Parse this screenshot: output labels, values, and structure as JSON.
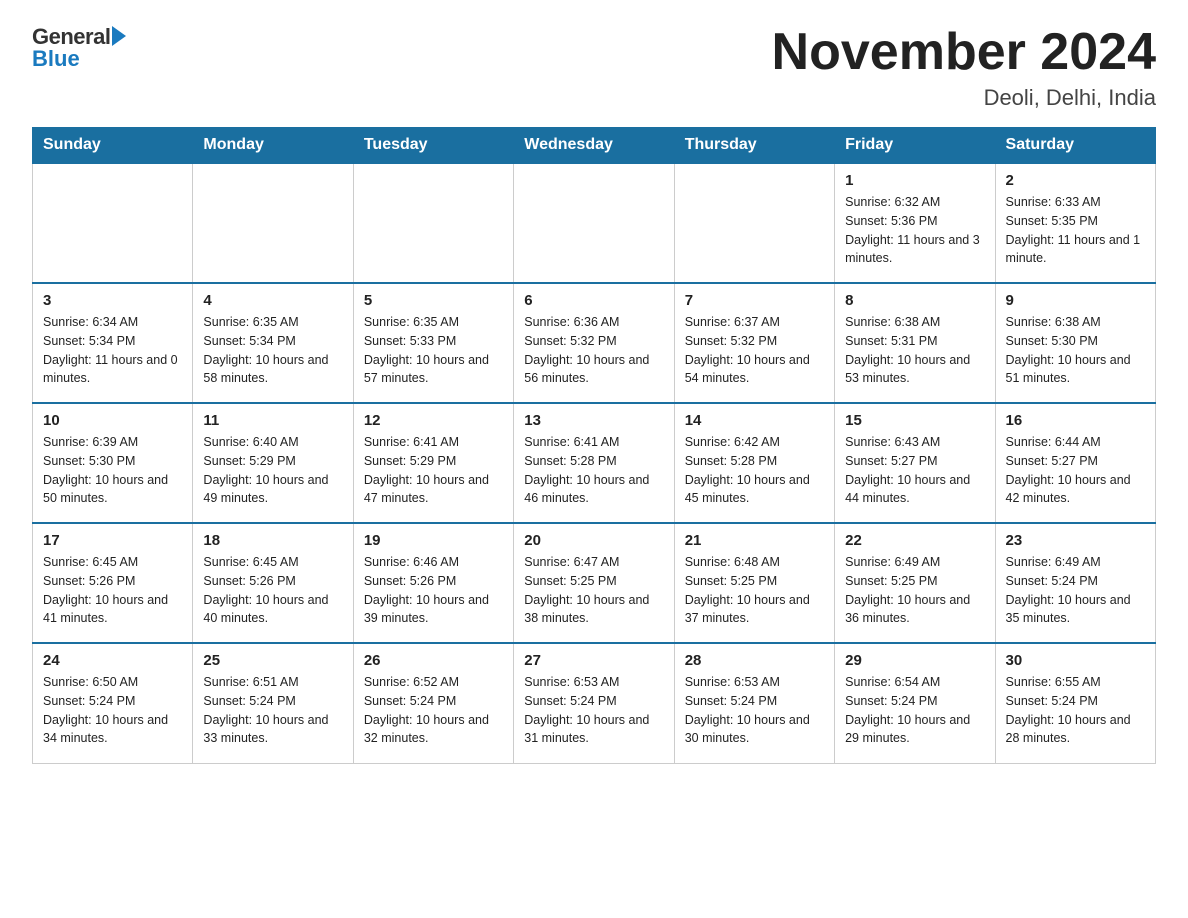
{
  "logo": {
    "general": "General",
    "blue": "Blue"
  },
  "header": {
    "month_year": "November 2024",
    "location": "Deoli, Delhi, India"
  },
  "weekdays": [
    "Sunday",
    "Monday",
    "Tuesday",
    "Wednesday",
    "Thursday",
    "Friday",
    "Saturday"
  ],
  "weeks": [
    [
      {
        "day": "",
        "info": ""
      },
      {
        "day": "",
        "info": ""
      },
      {
        "day": "",
        "info": ""
      },
      {
        "day": "",
        "info": ""
      },
      {
        "day": "",
        "info": ""
      },
      {
        "day": "1",
        "info": "Sunrise: 6:32 AM\nSunset: 5:36 PM\nDaylight: 11 hours and 3 minutes."
      },
      {
        "day": "2",
        "info": "Sunrise: 6:33 AM\nSunset: 5:35 PM\nDaylight: 11 hours and 1 minute."
      }
    ],
    [
      {
        "day": "3",
        "info": "Sunrise: 6:34 AM\nSunset: 5:34 PM\nDaylight: 11 hours and 0 minutes."
      },
      {
        "day": "4",
        "info": "Sunrise: 6:35 AM\nSunset: 5:34 PM\nDaylight: 10 hours and 58 minutes."
      },
      {
        "day": "5",
        "info": "Sunrise: 6:35 AM\nSunset: 5:33 PM\nDaylight: 10 hours and 57 minutes."
      },
      {
        "day": "6",
        "info": "Sunrise: 6:36 AM\nSunset: 5:32 PM\nDaylight: 10 hours and 56 minutes."
      },
      {
        "day": "7",
        "info": "Sunrise: 6:37 AM\nSunset: 5:32 PM\nDaylight: 10 hours and 54 minutes."
      },
      {
        "day": "8",
        "info": "Sunrise: 6:38 AM\nSunset: 5:31 PM\nDaylight: 10 hours and 53 minutes."
      },
      {
        "day": "9",
        "info": "Sunrise: 6:38 AM\nSunset: 5:30 PM\nDaylight: 10 hours and 51 minutes."
      }
    ],
    [
      {
        "day": "10",
        "info": "Sunrise: 6:39 AM\nSunset: 5:30 PM\nDaylight: 10 hours and 50 minutes."
      },
      {
        "day": "11",
        "info": "Sunrise: 6:40 AM\nSunset: 5:29 PM\nDaylight: 10 hours and 49 minutes."
      },
      {
        "day": "12",
        "info": "Sunrise: 6:41 AM\nSunset: 5:29 PM\nDaylight: 10 hours and 47 minutes."
      },
      {
        "day": "13",
        "info": "Sunrise: 6:41 AM\nSunset: 5:28 PM\nDaylight: 10 hours and 46 minutes."
      },
      {
        "day": "14",
        "info": "Sunrise: 6:42 AM\nSunset: 5:28 PM\nDaylight: 10 hours and 45 minutes."
      },
      {
        "day": "15",
        "info": "Sunrise: 6:43 AM\nSunset: 5:27 PM\nDaylight: 10 hours and 44 minutes."
      },
      {
        "day": "16",
        "info": "Sunrise: 6:44 AM\nSunset: 5:27 PM\nDaylight: 10 hours and 42 minutes."
      }
    ],
    [
      {
        "day": "17",
        "info": "Sunrise: 6:45 AM\nSunset: 5:26 PM\nDaylight: 10 hours and 41 minutes."
      },
      {
        "day": "18",
        "info": "Sunrise: 6:45 AM\nSunset: 5:26 PM\nDaylight: 10 hours and 40 minutes."
      },
      {
        "day": "19",
        "info": "Sunrise: 6:46 AM\nSunset: 5:26 PM\nDaylight: 10 hours and 39 minutes."
      },
      {
        "day": "20",
        "info": "Sunrise: 6:47 AM\nSunset: 5:25 PM\nDaylight: 10 hours and 38 minutes."
      },
      {
        "day": "21",
        "info": "Sunrise: 6:48 AM\nSunset: 5:25 PM\nDaylight: 10 hours and 37 minutes."
      },
      {
        "day": "22",
        "info": "Sunrise: 6:49 AM\nSunset: 5:25 PM\nDaylight: 10 hours and 36 minutes."
      },
      {
        "day": "23",
        "info": "Sunrise: 6:49 AM\nSunset: 5:24 PM\nDaylight: 10 hours and 35 minutes."
      }
    ],
    [
      {
        "day": "24",
        "info": "Sunrise: 6:50 AM\nSunset: 5:24 PM\nDaylight: 10 hours and 34 minutes."
      },
      {
        "day": "25",
        "info": "Sunrise: 6:51 AM\nSunset: 5:24 PM\nDaylight: 10 hours and 33 minutes."
      },
      {
        "day": "26",
        "info": "Sunrise: 6:52 AM\nSunset: 5:24 PM\nDaylight: 10 hours and 32 minutes."
      },
      {
        "day": "27",
        "info": "Sunrise: 6:53 AM\nSunset: 5:24 PM\nDaylight: 10 hours and 31 minutes."
      },
      {
        "day": "28",
        "info": "Sunrise: 6:53 AM\nSunset: 5:24 PM\nDaylight: 10 hours and 30 minutes."
      },
      {
        "day": "29",
        "info": "Sunrise: 6:54 AM\nSunset: 5:24 PM\nDaylight: 10 hours and 29 minutes."
      },
      {
        "day": "30",
        "info": "Sunrise: 6:55 AM\nSunset: 5:24 PM\nDaylight: 10 hours and 28 minutes."
      }
    ]
  ]
}
